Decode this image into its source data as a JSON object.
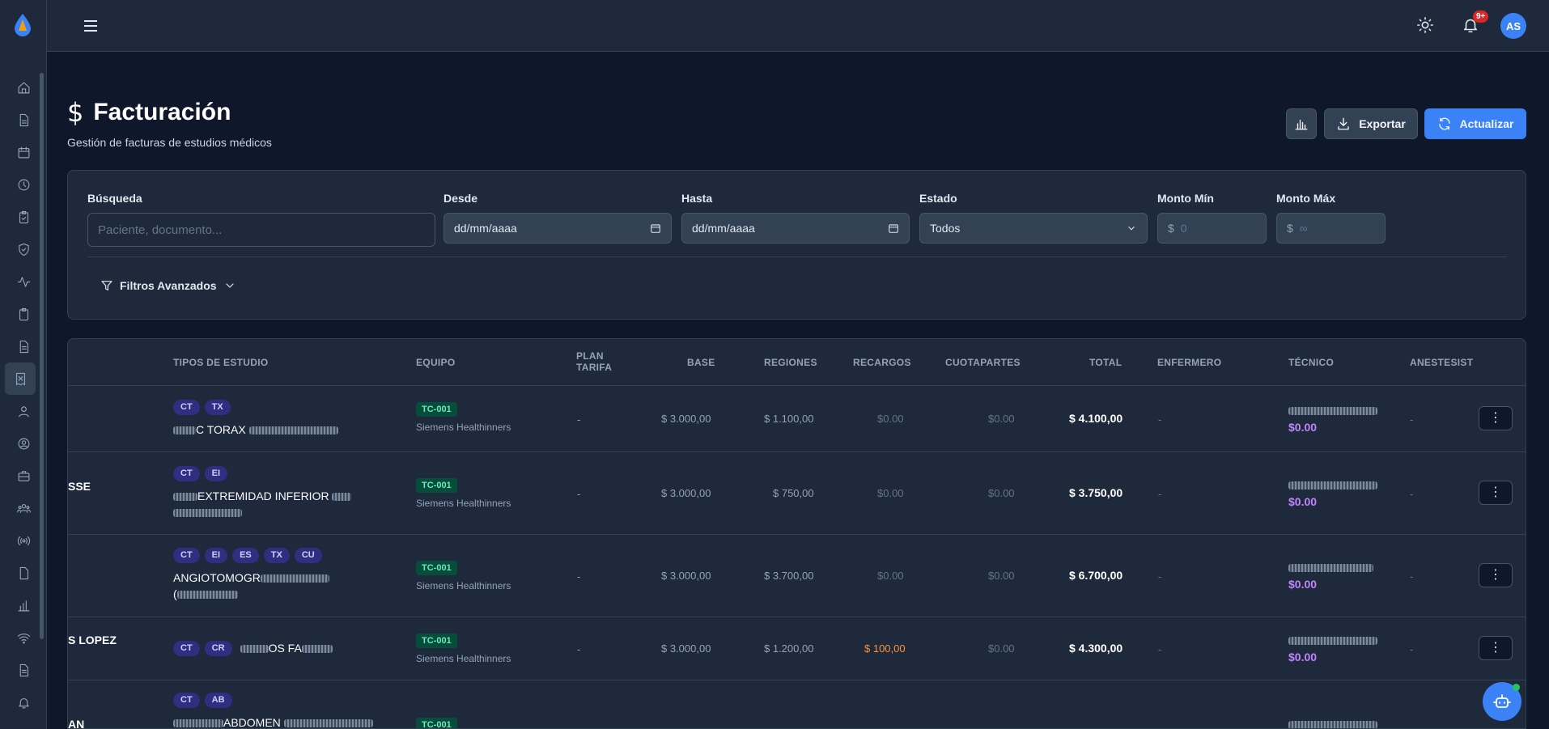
{
  "header": {
    "notifications_badge": "9+",
    "avatar_initials": "AS"
  },
  "page": {
    "title": "Facturación",
    "subtitle": "Gestión de facturas de estudios médicos",
    "title_icon": "$"
  },
  "actions": {
    "export_label": "Exportar",
    "refresh_label": "Actualizar"
  },
  "filters": {
    "search_label": "Búsqueda",
    "search_placeholder": "Paciente, documento...",
    "from_label": "Desde",
    "from_value": "dd/mm/aaaa",
    "to_label": "Hasta",
    "to_value": "dd/mm/aaaa",
    "status_label": "Estado",
    "status_value": "Todos",
    "min_label": "Monto Mín",
    "min_placeholder": "0",
    "max_label": "Monto Máx",
    "max_placeholder": "∞",
    "currency": "$",
    "advanced_label": "Filtros Avanzados"
  },
  "table": {
    "columns": {
      "tipos": "TIPOS DE ESTUDIO",
      "equipo": "EQUIPO",
      "plan_1": "PLAN",
      "plan_2": "TARIFA",
      "base": "BASE",
      "regiones": "REGIONES",
      "recargos": "RECARGOS",
      "cuotapartes": "CUOTAPARTES",
      "total": "TOTAL",
      "enfermero": "ENFERMERO",
      "tecnico": "TÉCNICO",
      "anestesista": "ANESTESIST"
    },
    "rows": [
      {
        "patient": "",
        "chips": [
          "CT",
          "TX"
        ],
        "study_text": "C TORAX",
        "study_text_2": "",
        "equip_code": "TC-001",
        "equip_name": "Siemens Healthinners",
        "plan": "-",
        "base": "$ 3.000,00",
        "regiones": "$ 1.100,00",
        "recargos": "$0.00",
        "cuotapartes": "$0.00",
        "total": "$ 4.100,00",
        "enfermero": "-",
        "tecnico_amount": "$0.00",
        "anestesista": "-"
      },
      {
        "patient": "SSE",
        "chips": [
          "CT",
          "EI"
        ],
        "study_text": "EXTREMIDAD INFERIOR",
        "study_text_2": "",
        "equip_code": "TC-001",
        "equip_name": "Siemens Healthinners",
        "plan": "-",
        "base": "$ 3.000,00",
        "regiones": "$ 750,00",
        "recargos": "$0.00",
        "cuotapartes": "$0.00",
        "total": "$ 3.750,00",
        "enfermero": "-",
        "tecnico_amount": "$0.00",
        "anestesista": "-"
      },
      {
        "patient": "",
        "chips": [
          "CT",
          "EI",
          "ES",
          "TX",
          "CU"
        ],
        "study_text": "ANGIOTOMOGR",
        "study_text_2": "(",
        "equip_code": "TC-001",
        "equip_name": "Siemens Healthinners",
        "plan": "-",
        "base": "$ 3.000,00",
        "regiones": "$ 3.700,00",
        "recargos": "$0.00",
        "cuotapartes": "$0.00",
        "total": "$ 6.700,00",
        "enfermero": "-",
        "tecnico_amount": "$0.00",
        "anestesista": "-"
      },
      {
        "patient": "S LOPEZ",
        "chips": [
          "CT",
          "CR"
        ],
        "study_text": "OS FA",
        "study_text_2": "",
        "equip_code": "TC-001",
        "equip_name": "Siemens Healthinners",
        "plan": "-",
        "base": "$ 3.000,00",
        "regiones": "$ 1.200,00",
        "recargos": "$ 100,00",
        "cuotapartes": "$0.00",
        "total": "$ 4.300,00",
        "enfermero": "-",
        "tecnico_amount": "$0.00",
        "anestesista": "-"
      },
      {
        "patient": "AN",
        "chips": [
          "CT",
          "AB"
        ],
        "study_text": "ABDOMEN",
        "study_text_2": "",
        "equip_code": "TC-001",
        "equip_name": "",
        "plan": "",
        "base": "",
        "regiones": "",
        "recargos": "",
        "cuotapartes": "",
        "total": "",
        "enfermero": "",
        "tecnico_amount": "",
        "anestesista": ""
      }
    ]
  }
}
